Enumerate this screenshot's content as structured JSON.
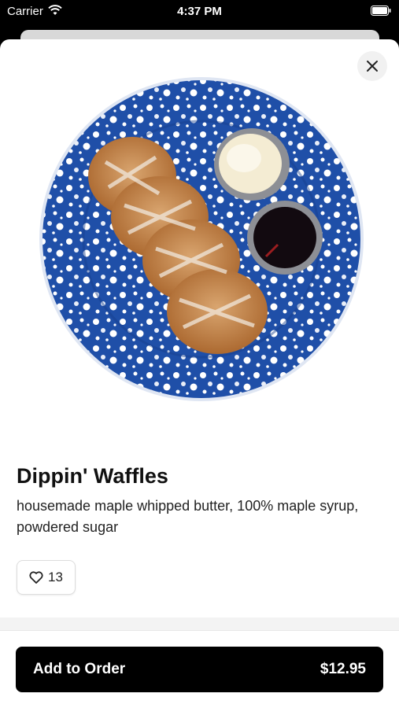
{
  "status_bar": {
    "carrier": "Carrier",
    "time": "4:37 PM"
  },
  "item": {
    "title": "Dippin' Waffles",
    "description": "housemade maple whipped butter, 100% maple syrup, powdered sugar",
    "likes": "13",
    "image_label": "Waffles with butter and syrup on blue speckled plate"
  },
  "order_button": {
    "label": "Add to Order",
    "price": "$12.95"
  },
  "icons": {
    "close": "close-icon",
    "like": "heart-icon",
    "wifi": "wifi-icon",
    "battery": "battery-icon"
  }
}
